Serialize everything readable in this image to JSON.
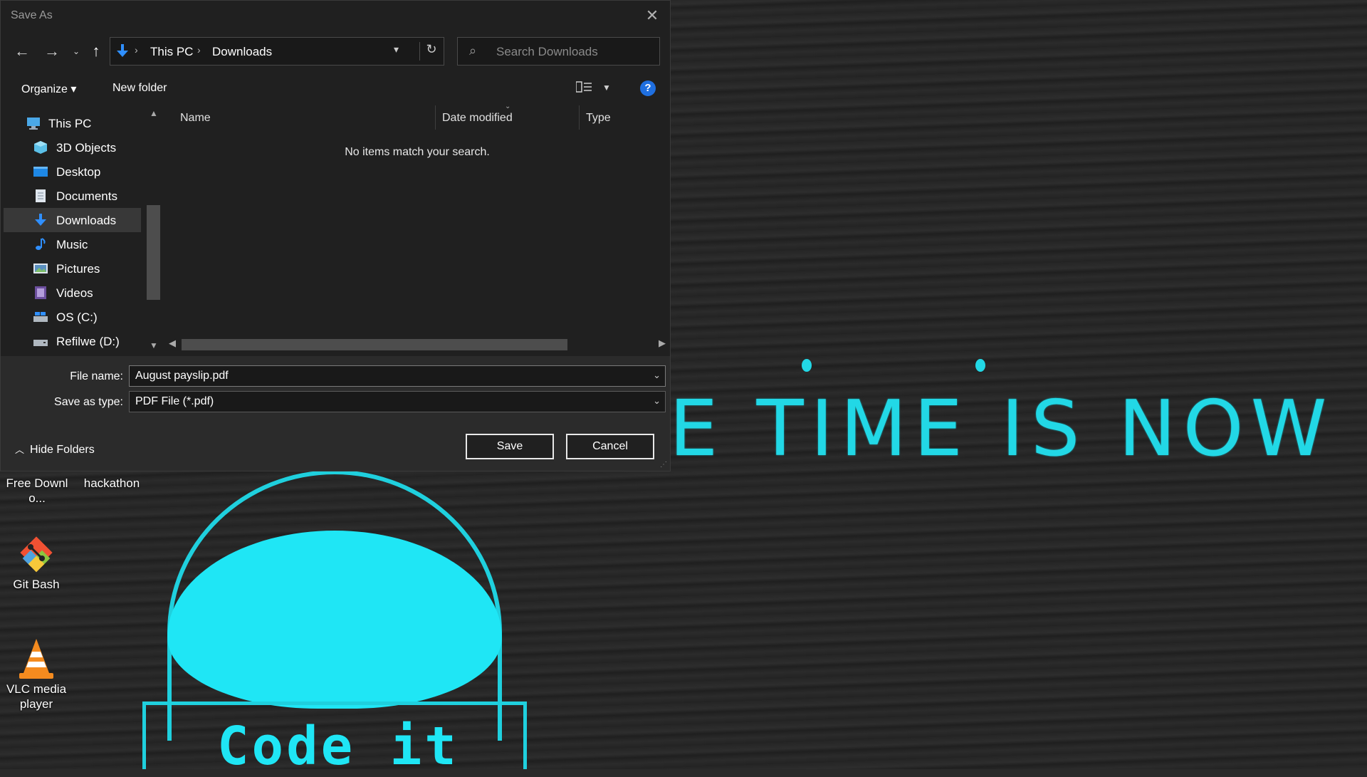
{
  "dialog": {
    "title": "Save As",
    "close_glyph": "✕",
    "address": {
      "root_segment": "This PC",
      "current_segment": "Downloads",
      "separator": "›"
    },
    "search_placeholder": "Search Downloads",
    "toolbar": {
      "organize_label": "Organize ▾",
      "new_folder_label": "New folder",
      "help_glyph": "?"
    },
    "nav_items": [
      {
        "label": "This PC",
        "icon": "this-pc-icon"
      },
      {
        "label": "3D Objects",
        "icon": "3d-objects-icon"
      },
      {
        "label": "Desktop",
        "icon": "desktop-folder-icon"
      },
      {
        "label": "Documents",
        "icon": "documents-icon"
      },
      {
        "label": "Downloads",
        "icon": "downloads-icon"
      },
      {
        "label": "Music",
        "icon": "music-icon"
      },
      {
        "label": "Pictures",
        "icon": "pictures-icon"
      },
      {
        "label": "Videos",
        "icon": "videos-icon"
      },
      {
        "label": "OS (C:)",
        "icon": "os-drive-icon"
      },
      {
        "label": "Refilwe (D:)",
        "icon": "drive-icon"
      }
    ],
    "selected_nav": "Downloads",
    "columns": [
      "Name",
      "Date modified",
      "Type"
    ],
    "empty_message": "No items match your search.",
    "file_name_label": "File name:",
    "file_name_value": "August payslip.pdf",
    "save_type_label": "Save as type:",
    "save_type_value": "PDF File (*.pdf)",
    "hide_folders_label": "Hide Folders",
    "save_label": "Save",
    "cancel_label": "Cancel"
  },
  "desktop": {
    "wallpaper_text": "E TIME IS NOW",
    "wallpaper_logo_text": "Code it",
    "icons": [
      {
        "label": "Free Downlo...",
        "icon": "free-download-icon"
      },
      {
        "label": "hackathon",
        "icon": "folder-icon"
      },
      {
        "label": "Git Bash",
        "icon": "git-bash-icon"
      },
      {
        "label": "VLC media player",
        "icon": "vlc-icon"
      }
    ]
  },
  "colors": {
    "dialog_bg": "#202020",
    "accent_cyan": "#1fe6f5",
    "help_blue": "#1f6fe0"
  }
}
